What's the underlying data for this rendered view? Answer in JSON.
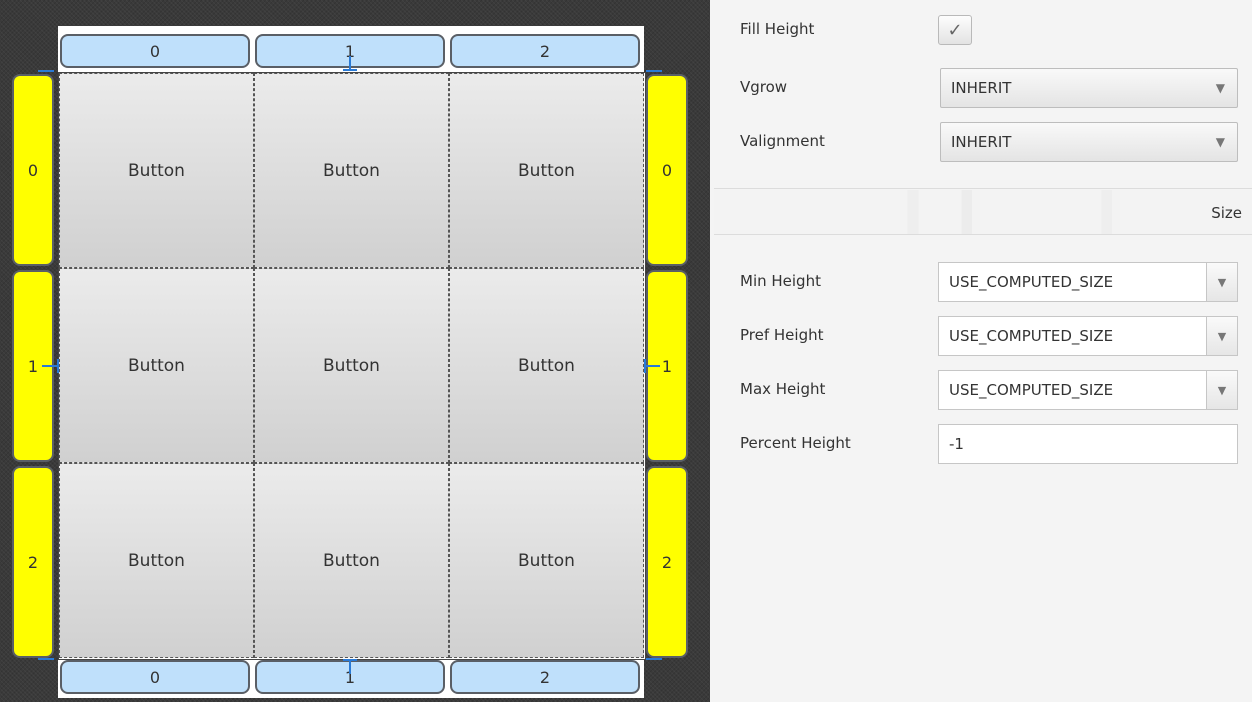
{
  "canvas": {
    "column_headers": [
      "0",
      "1",
      "2"
    ],
    "row_headers": [
      "0",
      "1",
      "2"
    ],
    "cells": [
      "Button",
      "Button",
      "Button",
      "Button",
      "Button",
      "Button",
      "Button",
      "Button",
      "Button"
    ],
    "colors": {
      "column_header": "#bfe0fb",
      "row_header": "#ffff00",
      "tick": "#2a7ad5"
    }
  },
  "inspector": {
    "fill_height": {
      "label": "Fill Height",
      "checked": true,
      "check_glyph": "✓"
    },
    "vgrow": {
      "label": "Vgrow",
      "value": "INHERIT"
    },
    "valignment": {
      "label": "Valignment",
      "value": "INHERIT"
    },
    "dropdown_arrow": "▼",
    "size_section": {
      "title": "Size",
      "min_height": {
        "label": "Min Height",
        "value": "USE_COMPUTED_SIZE"
      },
      "pref_height": {
        "label": "Pref Height",
        "value": "USE_COMPUTED_SIZE"
      },
      "max_height": {
        "label": "Max Height",
        "value": "USE_COMPUTED_SIZE"
      },
      "percent_height": {
        "label": "Percent Height",
        "value": "-1"
      }
    }
  }
}
